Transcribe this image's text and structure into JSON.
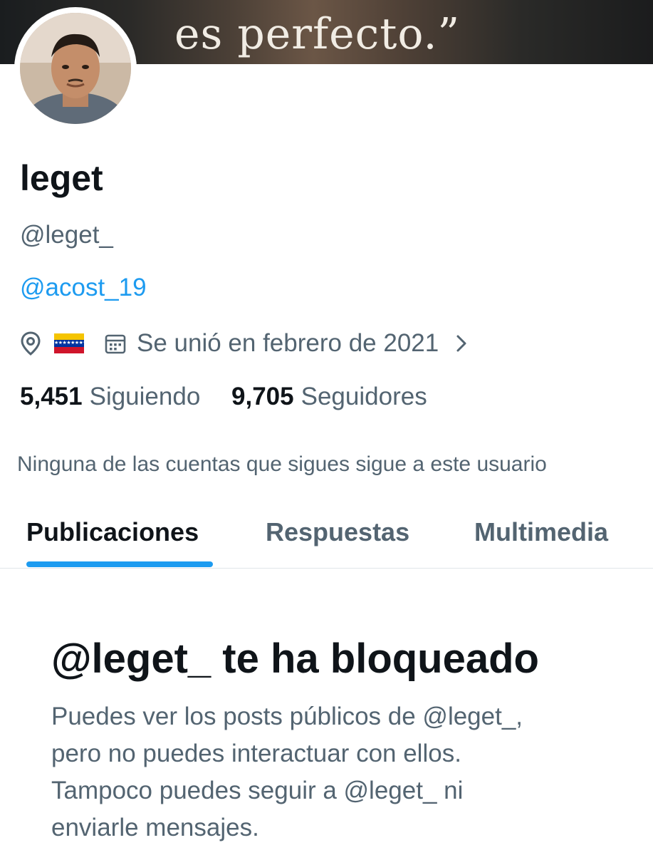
{
  "banner": {
    "quote_text": "es perfecto.”"
  },
  "profile": {
    "display_name": "leget",
    "handle": "@leget_",
    "bio_link": "@acost_19",
    "location_icon": "location-pin-icon",
    "location_flag": "venezuela-flag",
    "calendar_icon": "calendar-icon",
    "joined_text": "Se unió en febrero de 2021",
    "chevron_icon": "chevron-right-icon"
  },
  "stats": {
    "following_count": "5,451",
    "following_label": "Siguiendo",
    "followers_count": "9,705",
    "followers_label": "Seguidores"
  },
  "followed_by_note": "Ninguna de las cuentas que sigues sigue a este usuario",
  "tabs": [
    {
      "label": "Publicaciones",
      "active": true
    },
    {
      "label": "Respuestas",
      "active": false
    },
    {
      "label": "Multimedia",
      "active": false
    }
  ],
  "blocked_notice": {
    "title": "@leget_ te ha bloqueado",
    "body_lines": [
      "Puedes ver los posts públicos de @leget_,",
      "pero no puedes interactuar con ellos.",
      "Tampoco puedes seguir a @leget_ ni",
      "enviarle mensajes."
    ]
  },
  "colors": {
    "accent": "#1d9bf0",
    "text_primary": "#0f1419",
    "text_secondary": "#536471"
  }
}
